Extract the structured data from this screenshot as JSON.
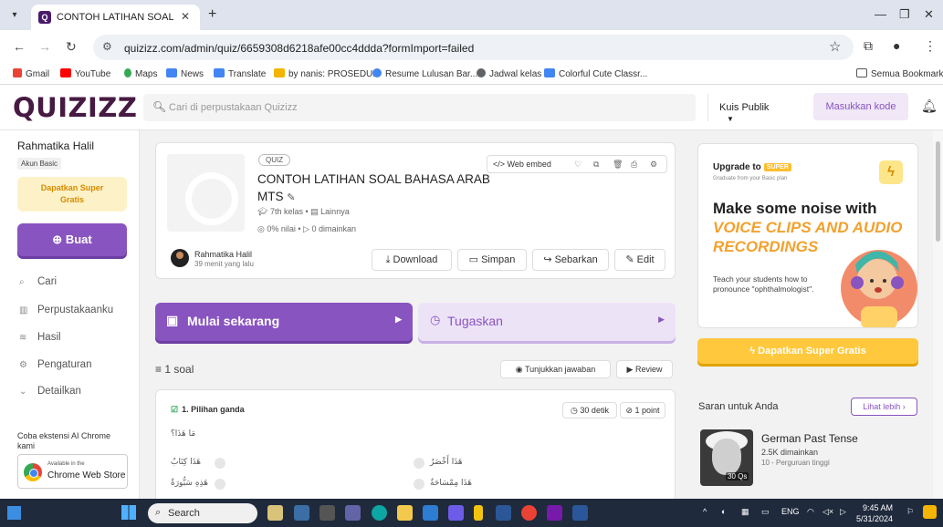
{
  "browser": {
    "tab_title": "CONTOH LATIHAN SOAL BAHA",
    "url": "quizizz.com/admin/quiz/6659308d6218afe00cc4ddda?formImport=failed",
    "bookmarks": [
      "Gmail",
      "YouTube",
      "Maps",
      "News",
      "Translate",
      "by nanis: PROSEDU...",
      "Resume Lulusan Bar...",
      "Jadwal kelas",
      "Colorful Cute Classr..."
    ],
    "all_bookmarks": "Semua Bookmark"
  },
  "header": {
    "logo": "QUIZIZZ",
    "search_placeholder": "Cari di perpustakaan Quizizz",
    "kuis_publik": "Kuis Publik",
    "masukkan_kode": "Masukkan kode"
  },
  "sidebar": {
    "user_name": "Rahmatika Halil",
    "plan": "Akun Basic",
    "super_line1": "Dapatkan Super",
    "super_line2": "Gratis",
    "buat": "Buat",
    "items": [
      {
        "label": "Cari",
        "icon": "search-icon"
      },
      {
        "label": "Perpustakaanku",
        "icon": "library-icon"
      },
      {
        "label": "Hasil",
        "icon": "chart-icon"
      },
      {
        "label": "Pengaturan",
        "icon": "gear-icon"
      },
      {
        "label": "Detailkan",
        "icon": "chevron-down-icon"
      }
    ],
    "extension_promo": "Coba ekstensi AI Chrome kami",
    "chrome_small": "Available in the",
    "chrome_big": "Chrome Web Store"
  },
  "quiz": {
    "tag": "QUIZ",
    "title": "CONTOH LATIHAN SOAL BAHASA ARAB MTS",
    "grade": "7th kelas",
    "subject": "Lainnya",
    "accuracy": "0% nilai",
    "played": "0 dimainkan",
    "web_embed": "Web embed",
    "author": "Rahmatika Halil",
    "time_ago": "39 menit yang lalu",
    "download": "Download",
    "simpan": "Simpan",
    "sebarkan": "Sebarkan",
    "edit": "Edit"
  },
  "actions": {
    "mulai": "Mulai sekarang",
    "tugaskan": "Tugaskan"
  },
  "questions": {
    "count": "1 soal",
    "show_answers": "Tunjukkan jawaban",
    "review": "Review",
    "q1": {
      "type": "1. Pilihan ganda",
      "time": "30 detik",
      "points": "1 point",
      "text": "مَا هَذَا؟",
      "options": [
        "هَذَا كِتَابٌ",
        "هَذَا أَخْضَرُ",
        "هَذِهِ سَبُّورَةٌ",
        "هَذَا مِمْسَاحَةٌ"
      ]
    }
  },
  "upgrade": {
    "title": "Upgrade to",
    "badge": "SUPER",
    "subtitle": "Graduate from your Basic plan",
    "headline_plain": "Make some noise with",
    "headline_highlight": "VOICE CLIPS AND AUDIO RECORDINGS",
    "teach": "Teach your students how to pronounce \"ophthalmologist\".",
    "cta": "Dapatkan Super Gratis"
  },
  "suggestions": {
    "title": "Saran untuk Anda",
    "see_more": "Lihat lebih",
    "item": {
      "title": "German Past Tense",
      "plays": "2.5K dimainkan",
      "level": "10 - Perguruan tinggi",
      "qs": "30 Qs"
    }
  },
  "taskbar": {
    "search": "Search",
    "lang": "ENG",
    "time": "9:45 AM",
    "date": "5/31/2024"
  },
  "colors": {
    "brand_purple": "#8854c0",
    "logo": "#461a42",
    "super_yellow": "#ffc83d"
  }
}
